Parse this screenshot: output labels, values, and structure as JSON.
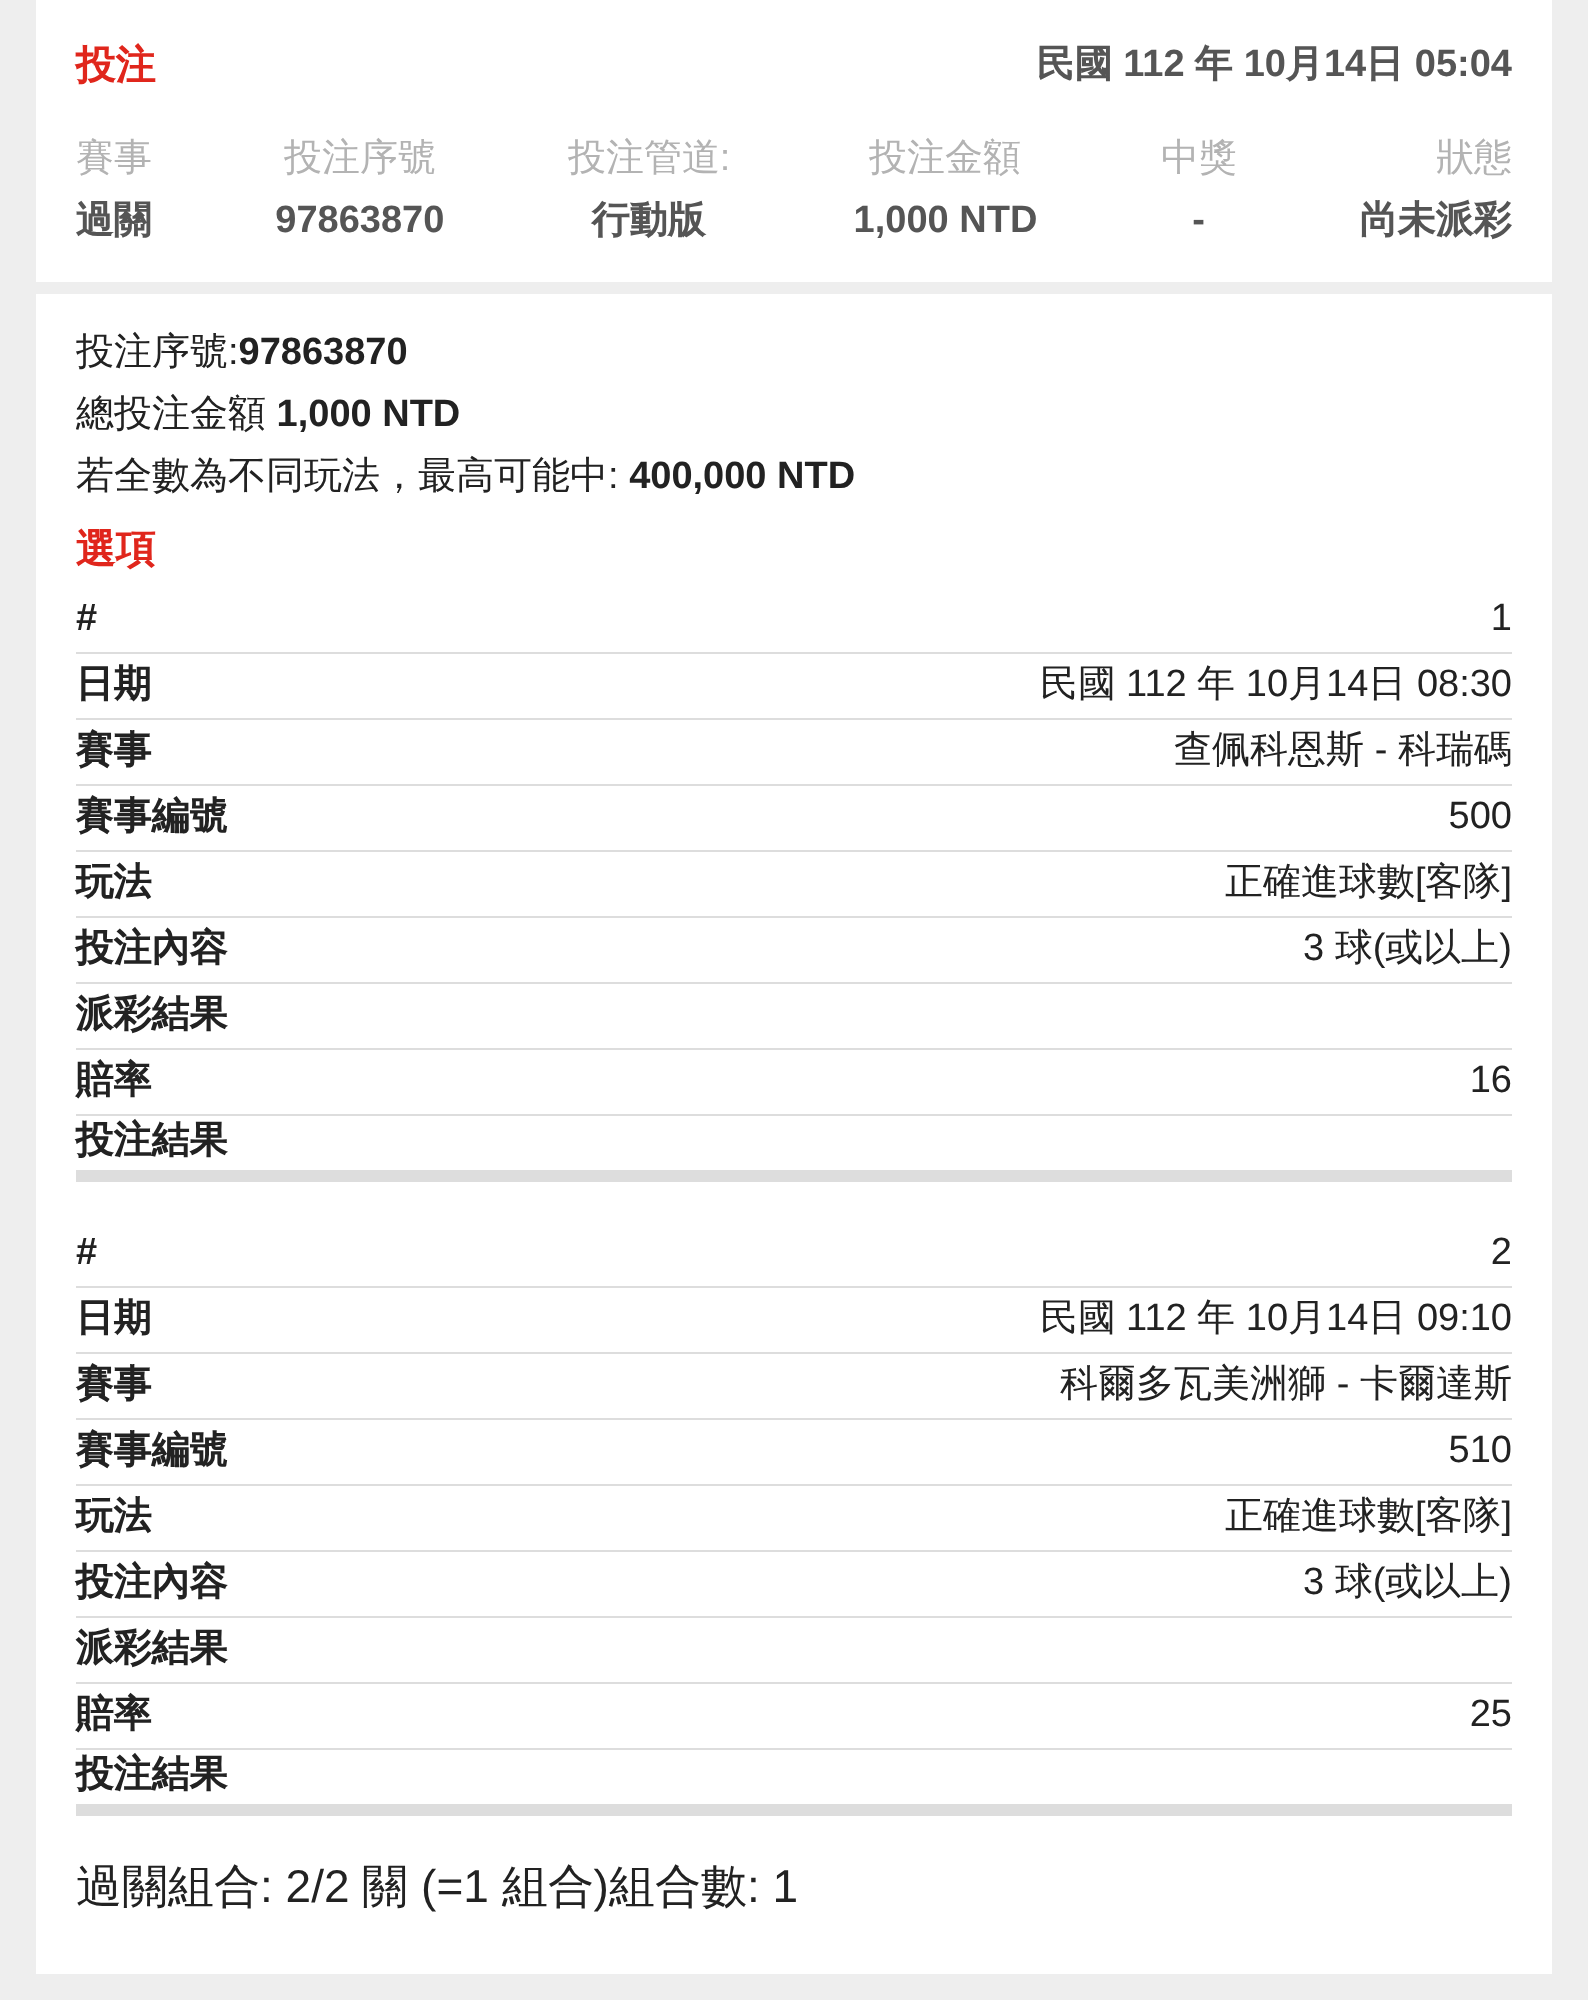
{
  "header": {
    "title": "投注",
    "datetime": "民國 112 年 10月14日 05:04"
  },
  "summary_table": {
    "columns": [
      "賽事",
      "投注序號",
      "投注管道:",
      "投注金額",
      "中獎",
      "狀態"
    ],
    "values": [
      "過關",
      "97863870",
      "行動版",
      "1,000 NTD",
      "-",
      "尚未派彩"
    ]
  },
  "details": [
    "投注序號:**97863870**",
    "總投注金額 **1,000 NTD**",
    "若全數為不同玩法，最高可能中: **400,000 NTD**"
  ],
  "options_title": "選項",
  "legs": [
    {
      "rows": [
        {
          "label": "#",
          "value": "1"
        },
        {
          "label": "日期",
          "value": "民國 112 年 10月14日 08:30"
        },
        {
          "label": "賽事",
          "value": "查佩科恩斯 - 科瑞碼"
        },
        {
          "label": "賽事編號",
          "value": "500"
        },
        {
          "label": "玩法",
          "value": "正確進球數[客隊]"
        },
        {
          "label": "投注內容",
          "value": "3 球(或以上)"
        },
        {
          "label": "派彩結果"
        },
        {
          "label": "賠率",
          "value": "16"
        },
        {
          "label": "投注結果"
        }
      ]
    },
    {
      "rows": [
        {
          "label": "#",
          "value": "2"
        },
        {
          "label": "日期",
          "value": "民國 112 年 10月14日 09:10"
        },
        {
          "label": "賽事",
          "value": "科爾多瓦美洲獅 - 卡爾達斯"
        },
        {
          "label": "賽事編號",
          "value": "510"
        },
        {
          "label": "玩法",
          "value": "正確進球數[客隊]"
        },
        {
          "label": "投注內容",
          "value": "3 球(或以上)"
        },
        {
          "label": "派彩結果"
        },
        {
          "label": "賠率",
          "value": "25"
        },
        {
          "label": "投注結果"
        }
      ]
    }
  ],
  "combo": "過關組合: 2/2 關 (=1 組合)組合數: 1"
}
